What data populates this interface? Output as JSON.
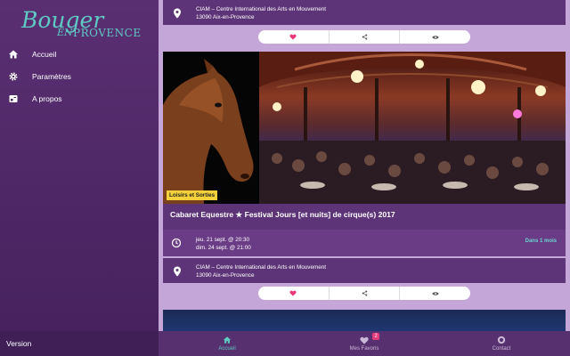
{
  "app": {
    "logo_top": "Bouger",
    "logo_en": "EN",
    "logo_bottom": "PROVENCE"
  },
  "sidebar": {
    "items": [
      {
        "label": "Accueil",
        "icon": "home-icon"
      },
      {
        "label": "Paramètres",
        "icon": "gear-icon"
      },
      {
        "label": "A propos",
        "icon": "info-card-icon"
      }
    ],
    "version_label": "Version"
  },
  "feed": {
    "prev_card": {
      "location_line1": "CIAM – Centre International des Arts en Mouvement",
      "location_line2": "13090 Aix-en-Provence"
    },
    "card": {
      "category": "Loisirs et Sorties",
      "title": "Cabaret Equestre ★ Festival Jours [et nuits] de cirque(s) 2017",
      "date_line1": "jeu. 21 sept. @ 20:30",
      "date_line2": "dim. 24 sept. @ 21:00",
      "relative_time": "Dans 1 mois",
      "location_line1": "CIAM – Centre International des Arts en Mouvement",
      "location_line2": "13090 Aix-en-Provence"
    }
  },
  "tabbar": {
    "tabs": [
      {
        "label": "Accueil",
        "icon": "home-icon",
        "active": true
      },
      {
        "label": "Mes Favoris",
        "icon": "heart-icon",
        "badge": "2"
      },
      {
        "label": "Contact",
        "icon": "contact-icon"
      }
    ]
  },
  "colors": {
    "sidebar": "#4d2765",
    "accent": "#5fc9c4",
    "card": "#5e3478",
    "favorite": "#e83a7a",
    "tag": "#f4d13b"
  }
}
